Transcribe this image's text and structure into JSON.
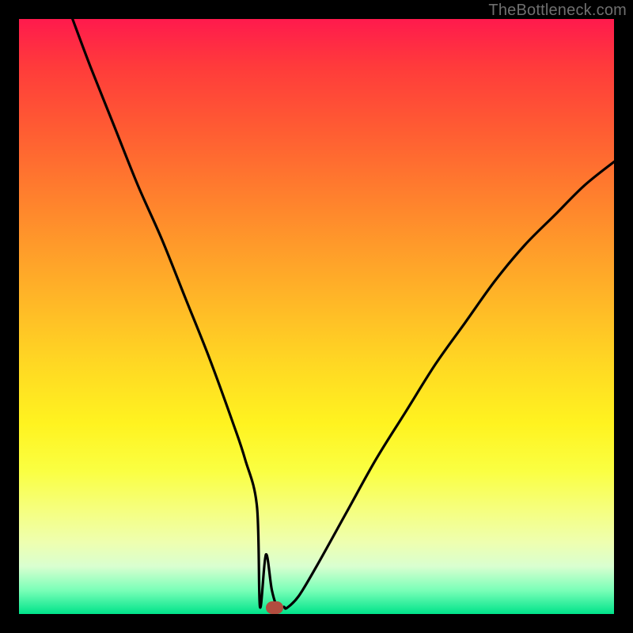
{
  "watermark": "TheBottleneck.com",
  "colors": {
    "frame": "#000000",
    "gradient_top": "#ff1a4d",
    "gradient_bottom": "#00e38a",
    "curve": "#000000",
    "marker": "#b24d3f"
  },
  "chart_data": {
    "type": "line",
    "title": "",
    "xlabel": "",
    "ylabel": "",
    "xlim": [
      0,
      100
    ],
    "ylim": [
      0,
      100
    ],
    "series": [
      {
        "name": "bottleneck-curve",
        "x": [
          9,
          12,
          16,
          20,
          24,
          28,
          32,
          36,
          38,
          40,
          41.5,
          42.5,
          43.5,
          45,
          47,
          50,
          55,
          60,
          65,
          70,
          75,
          80,
          85,
          90,
          95,
          100
        ],
        "y": [
          100,
          92,
          82,
          72,
          63,
          53,
          43,
          32,
          26,
          18,
          10,
          4,
          1,
          1,
          3,
          8,
          17,
          26,
          34,
          42,
          49,
          56,
          62,
          67,
          72,
          76
        ]
      }
    ],
    "marker": {
      "x": 43,
      "y": 1
    },
    "flat_segment": {
      "x0": 40.5,
      "x1": 44.5,
      "y": 1.2
    }
  }
}
